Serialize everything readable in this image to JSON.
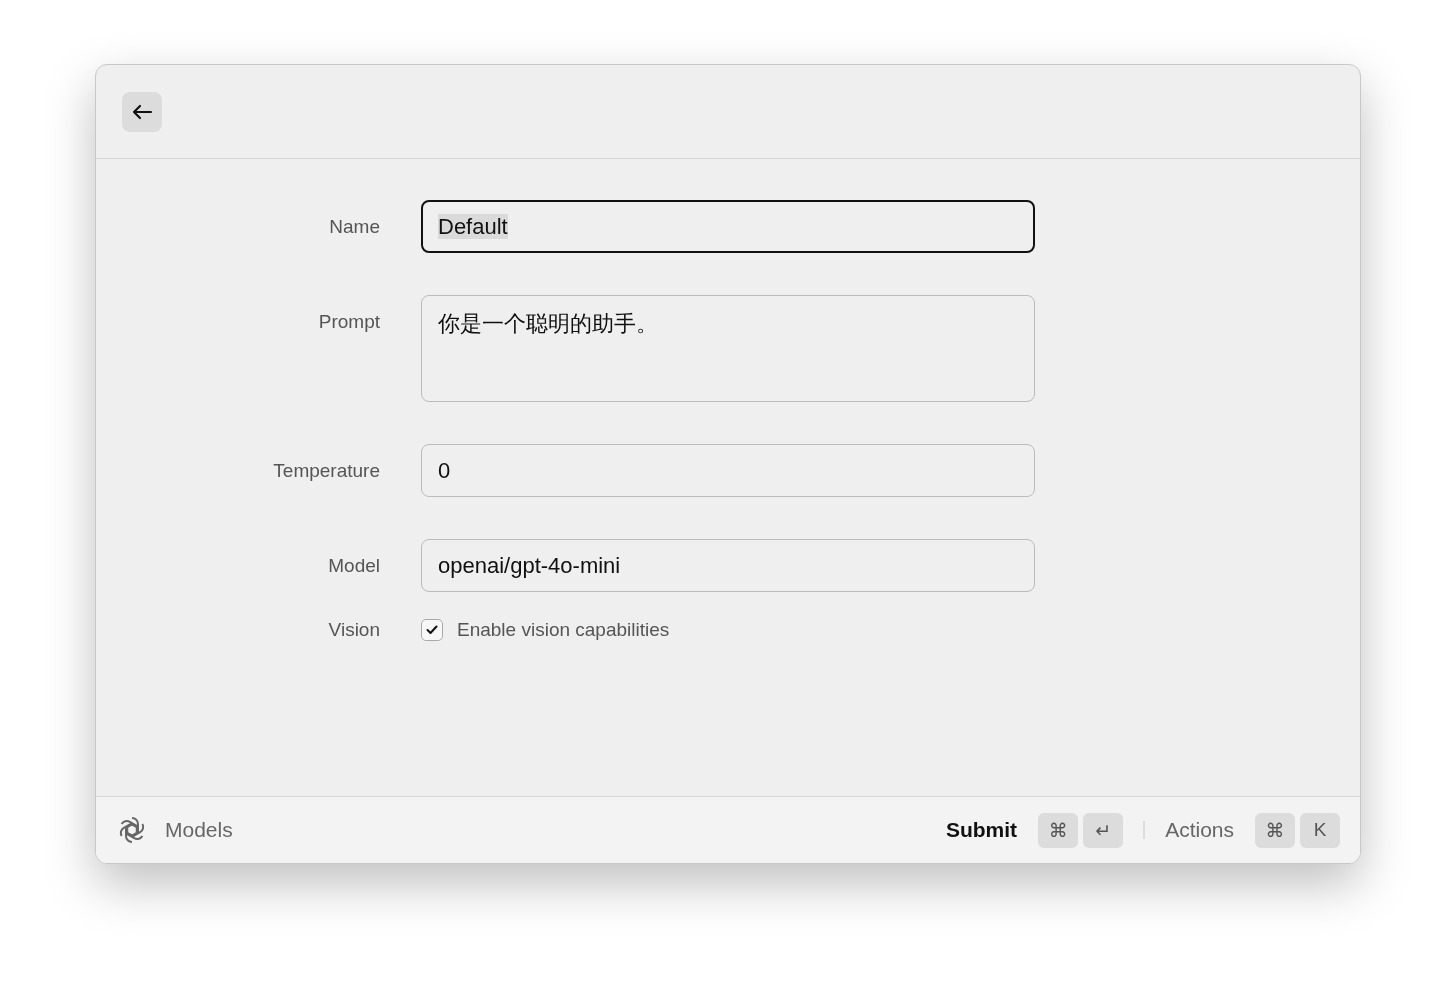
{
  "form": [
    {
      "kind": "text",
      "label": "Name",
      "value": "Default",
      "focused": true,
      "text_selected": true
    },
    {
      "kind": "textarea",
      "label": "Prompt",
      "value": "你是一个聪明的助手。",
      "focused": false,
      "text_selected": false
    },
    {
      "kind": "text",
      "label": "Temperature",
      "value": "0",
      "focused": false,
      "text_selected": false
    },
    {
      "kind": "text",
      "label": "Model",
      "value": "openai/gpt-4o-mini",
      "focused": false,
      "text_selected": false
    },
    {
      "kind": "checkbox",
      "label": "Vision",
      "value": "Enable vision capabilities",
      "checked": true
    }
  ],
  "footer": {
    "title": "Models",
    "primary_action": {
      "label": "Submit",
      "keys": [
        "⌘",
        "↵"
      ]
    },
    "secondary_action": {
      "label": "Actions",
      "keys": [
        "⌘",
        "K"
      ]
    }
  }
}
